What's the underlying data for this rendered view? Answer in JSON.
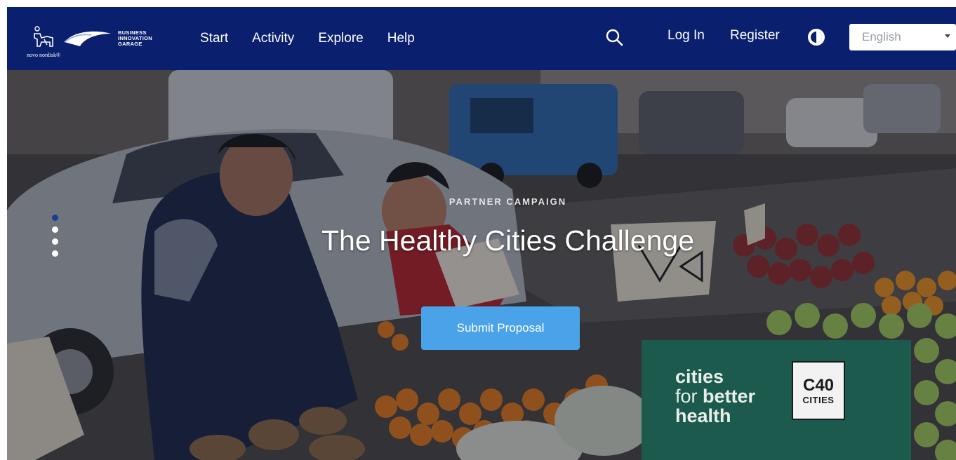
{
  "colors": {
    "navbar_bg": "#0a1f6e",
    "cta_bg": "#4aa3e8",
    "partner_bg": "#1b5a4d",
    "active_dot": "#1d3c8f"
  },
  "brand": {
    "novo_text": "novo nordisk®",
    "garage_lines": [
      "BUSINESS",
      "INNOVATION",
      "GARAGE"
    ]
  },
  "nav": {
    "links": [
      "Start",
      "Activity",
      "Explore",
      "Help"
    ],
    "login": "Log In",
    "register": "Register",
    "search_icon": "search-icon",
    "contrast_icon": "contrast-icon",
    "language": "English"
  },
  "hero": {
    "eyebrow": "PARTNER CAMPAIGN",
    "title": "The Healthy Cities Challenge",
    "cta": "Submit Proposal",
    "carousel_count": 4,
    "active_slide": 1
  },
  "partner": {
    "line1": "cities",
    "line2_prefix": "for ",
    "line2_bold": "better",
    "line3": "health",
    "c40_main": "C40",
    "c40_sub": "CITIES"
  }
}
